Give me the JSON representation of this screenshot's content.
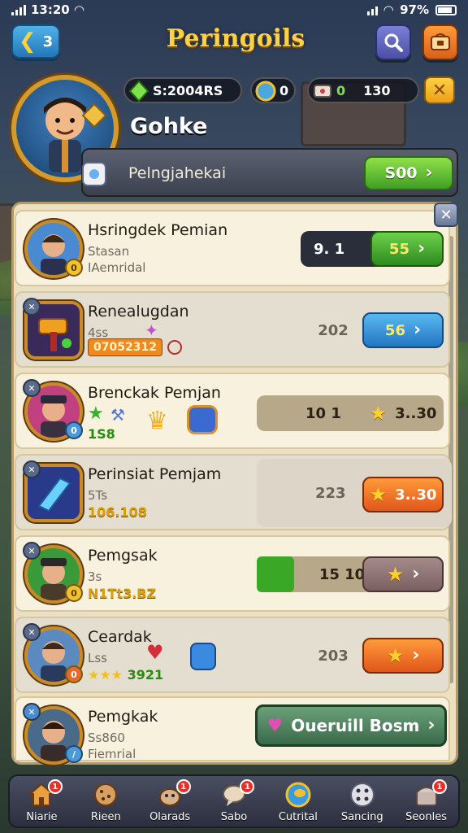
{
  "status_bar": {
    "time": "13:20",
    "battery": "97%"
  },
  "header": {
    "back_count": "3",
    "title": "Peringoils"
  },
  "currencies": {
    "gems": "S:2004RS",
    "coins": "0",
    "tickets": "0",
    "ticket_total": "130"
  },
  "profile": {
    "name": "Gohke",
    "bar_label": "Pelngjahekai",
    "bar_button": "S00"
  },
  "rows": [
    {
      "name": "Hsringdek Pemian",
      "sub1": "Stasan",
      "sub2": "IAemridal",
      "value_left": "9. 1",
      "button": "55",
      "level": "0"
    },
    {
      "name": "Renealugdan",
      "sub1": "4ss",
      "tag": "07052312",
      "value": "202",
      "button": "56"
    },
    {
      "name": "Brenckak Pemjan",
      "extra": "1S8",
      "value": "10 1",
      "button": "3..30",
      "level": "0"
    },
    {
      "name": "Perinsiat Pemjam",
      "sub1": "5Ts",
      "gold": "106.108",
      "value": "223",
      "button": "3..30"
    },
    {
      "name": "Pemgsak",
      "sub1": "3s",
      "gold": "N1Tt3.BZ",
      "value": "15 10",
      "progress": 0.2,
      "level": "0"
    },
    {
      "name": "Ceardak",
      "sub1": "Lss",
      "gold": "3921",
      "value": "203",
      "level": "0"
    },
    {
      "name": "Pemgkak",
      "sub1": "Ss860",
      "sub2": "Fiemrial",
      "button": "Oueruill Bosm"
    }
  ],
  "nav": [
    {
      "label": "Niarie",
      "badge": "1",
      "icon": "home-icon"
    },
    {
      "label": "Rieen",
      "badge": "",
      "icon": "cookie-icon"
    },
    {
      "label": "Olarads",
      "badge": "1",
      "icon": "pet-icon"
    },
    {
      "label": "Sabo",
      "badge": "1",
      "icon": "chat-icon"
    },
    {
      "label": "Cutrital",
      "badge": "",
      "icon": "wallet-icon"
    },
    {
      "label": "Sancing",
      "badge": "",
      "icon": "dice-icon"
    },
    {
      "label": "Seonles",
      "badge": "1",
      "icon": "chest-icon"
    }
  ]
}
